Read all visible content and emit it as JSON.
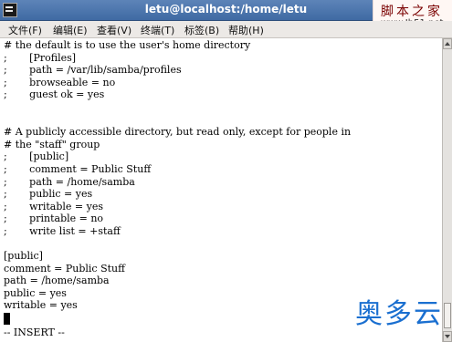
{
  "window": {
    "title": "letu@localhost:/home/letu"
  },
  "watermark_top": {
    "line1": "脚本之家",
    "line2": "www.Jb51.net"
  },
  "watermark_logo": "奥多云",
  "menu": [
    {
      "label": "文件(F)"
    },
    {
      "label": "编辑(E)"
    },
    {
      "label": "查看(V)"
    },
    {
      "label": "终端(T)"
    },
    {
      "label": "标签(B)"
    },
    {
      "label": "帮助(H)"
    }
  ],
  "terminal": {
    "lines": [
      "# the default is to use the user's home directory",
      ";       [Profiles]",
      ";       path = /var/lib/samba/profiles",
      ";       browseable = no",
      ";       guest ok = yes",
      "",
      "",
      "# A publicly accessible directory, but read only, except for people in",
      "# the \"staff\" group",
      ";       [public]",
      ";       comment = Public Stuff",
      ";       path = /home/samba",
      ";       public = yes",
      ";       writable = yes",
      ";       printable = no",
      ";       write list = +staff",
      "",
      "[public]",
      "comment = Public Stuff",
      "path = /home/samba",
      "public = yes",
      "writable = yes"
    ],
    "mode": "-- INSERT --"
  }
}
